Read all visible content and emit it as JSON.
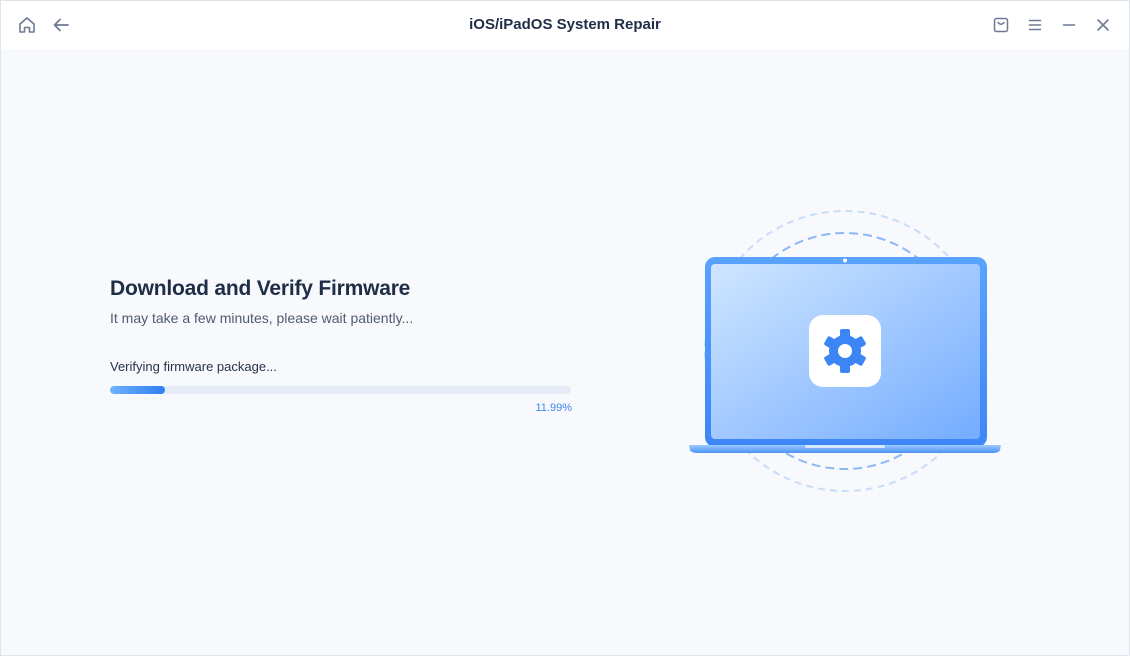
{
  "window": {
    "title": "iOS/iPadOS System Repair"
  },
  "titlebar": {
    "icons": [
      "home-icon",
      "back-arrow-icon",
      "feedback-icon",
      "menu-icon",
      "minimize-icon",
      "close-icon"
    ]
  },
  "main": {
    "heading": "Download and Verify Firmware",
    "subheading": "It may take a few minutes, please wait patiently...",
    "status": "Verifying firmware package...",
    "progress": {
      "percent_label": "11.99%",
      "fraction": 0.1199
    }
  },
  "colors": {
    "accent": "#2f7ef4",
    "heading": "#1f2d46",
    "background": "#f7f9fd"
  }
}
